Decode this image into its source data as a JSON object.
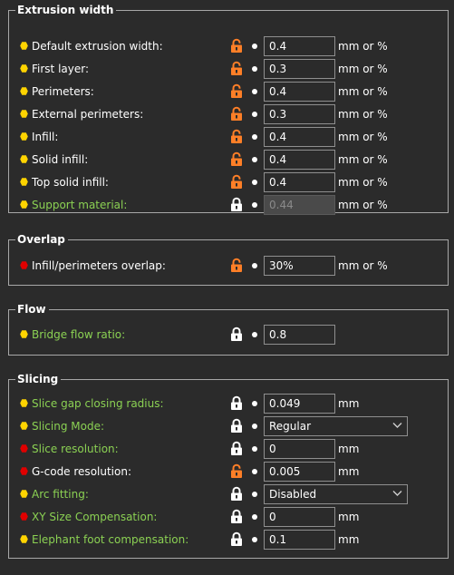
{
  "colors": {
    "background": "#2b2b2b",
    "bullet_yellow": "#ffd400",
    "bullet_red": "#e00000",
    "lock_orange": "#ff7f27",
    "lock_white": "#ffffff",
    "label_green": "#8bd153"
  },
  "groups": [
    {
      "title": "Extrusion width",
      "rows": [
        {
          "label": "Default extrusion width:",
          "bullet": "yellow",
          "label_color": "white",
          "lock": "unlocked",
          "kind": "field",
          "value": "0.4",
          "unit": "mm or %",
          "disabled": false
        },
        {
          "label": "First layer:",
          "bullet": "yellow",
          "label_color": "white",
          "lock": "unlocked",
          "kind": "field",
          "value": "0.3",
          "unit": "mm or %",
          "disabled": false
        },
        {
          "label": "Perimeters:",
          "bullet": "yellow",
          "label_color": "white",
          "lock": "unlocked",
          "kind": "field",
          "value": "0.4",
          "unit": "mm or %",
          "disabled": false
        },
        {
          "label": "External perimeters:",
          "bullet": "yellow",
          "label_color": "white",
          "lock": "unlocked",
          "kind": "field",
          "value": "0.3",
          "unit": "mm or %",
          "disabled": false
        },
        {
          "label": "Infill:",
          "bullet": "yellow",
          "label_color": "white",
          "lock": "unlocked",
          "kind": "field",
          "value": "0.4",
          "unit": "mm or %",
          "disabled": false
        },
        {
          "label": "Solid infill:",
          "bullet": "yellow",
          "label_color": "white",
          "lock": "unlocked",
          "kind": "field",
          "value": "0.4",
          "unit": "mm or %",
          "disabled": false
        },
        {
          "label": "Top solid infill:",
          "bullet": "yellow",
          "label_color": "white",
          "lock": "unlocked",
          "kind": "field",
          "value": "0.4",
          "unit": "mm or %",
          "disabled": false
        },
        {
          "label": "Support material:",
          "bullet": "yellow",
          "label_color": "green",
          "lock": "locked",
          "kind": "field",
          "value": "0.44",
          "unit": "mm or %",
          "disabled": true
        }
      ]
    },
    {
      "title": "Overlap",
      "rows": [
        {
          "label": "Infill/perimeters overlap:",
          "bullet": "red",
          "label_color": "white",
          "lock": "unlocked",
          "kind": "field",
          "value": "30%",
          "unit": "mm or %",
          "disabled": false
        }
      ]
    },
    {
      "title": "Flow",
      "rows": [
        {
          "label": "Bridge flow ratio:",
          "bullet": "yellow",
          "label_color": "green",
          "lock": "locked",
          "kind": "field",
          "value": "0.8",
          "unit": "",
          "disabled": false
        }
      ]
    },
    {
      "title": "Slicing",
      "rows": [
        {
          "label": "Slice gap closing radius:",
          "bullet": "yellow",
          "label_color": "green",
          "lock": "locked",
          "kind": "field",
          "value": "0.049",
          "unit": "mm",
          "disabled": false
        },
        {
          "label": "Slicing Mode:",
          "bullet": "yellow",
          "label_color": "green",
          "lock": "locked",
          "kind": "select",
          "value": "Regular",
          "unit": "",
          "disabled": false
        },
        {
          "label": "Slice resolution:",
          "bullet": "red",
          "label_color": "green",
          "lock": "locked",
          "kind": "field",
          "value": "0",
          "unit": "mm",
          "disabled": false
        },
        {
          "label": "G-code resolution:",
          "bullet": "red",
          "label_color": "white",
          "lock": "unlocked",
          "kind": "field",
          "value": "0.005",
          "unit": "mm",
          "disabled": false
        },
        {
          "label": "Arc fitting:",
          "bullet": "yellow",
          "label_color": "green",
          "lock": "locked",
          "kind": "select",
          "value": "Disabled",
          "unit": "",
          "disabled": false
        },
        {
          "label": "XY Size Compensation:",
          "bullet": "red",
          "label_color": "green",
          "lock": "locked",
          "kind": "field",
          "value": "0",
          "unit": "mm",
          "disabled": false
        },
        {
          "label": "Elephant foot compensation:",
          "bullet": "yellow",
          "label_color": "green",
          "lock": "locked",
          "kind": "field",
          "value": "0.1",
          "unit": "mm",
          "disabled": false
        }
      ]
    }
  ]
}
